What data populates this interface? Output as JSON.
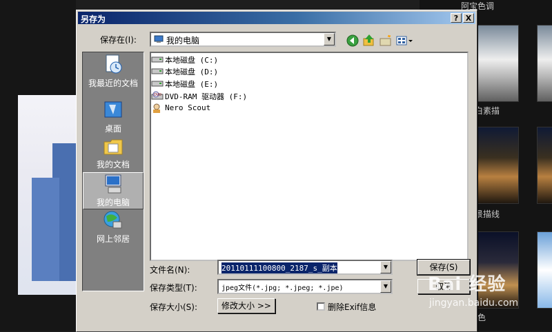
{
  "background": {
    "right_labels": [
      "阿宝色调",
      "黑白素描",
      "夜景描线",
      "单色"
    ]
  },
  "dialog": {
    "title": "另存为",
    "help_button": "?",
    "close_button": "X",
    "save_in_label": "保存在(I):",
    "save_in_value": "我的电脑",
    "places": [
      {
        "label": "我最近的文档",
        "icon": "recent-documents-icon"
      },
      {
        "label": "桌面",
        "icon": "desktop-icon"
      },
      {
        "label": "我的文档",
        "icon": "my-documents-icon"
      },
      {
        "label": "我的电脑",
        "icon": "my-computer-icon",
        "selected": true
      },
      {
        "label": "网上邻居",
        "icon": "network-places-icon"
      }
    ],
    "files": [
      {
        "name": "本地磁盘 (C:)",
        "icon": "hard-drive-icon"
      },
      {
        "name": "本地磁盘 (D:)",
        "icon": "hard-drive-icon"
      },
      {
        "name": "本地磁盘 (E:)",
        "icon": "hard-drive-icon"
      },
      {
        "name": "DVD-RAM 驱动器 (F:)",
        "icon": "dvd-drive-icon"
      },
      {
        "name": "Nero Scout",
        "icon": "nero-scout-icon"
      }
    ],
    "filename_label": "文件名(N):",
    "filename_value": "20110111100800_2187_s_副本",
    "filetype_label": "保存类型(T):",
    "filetype_value": "jpeg文件(*.jpg; *.jpeg; *.jpe)",
    "filesize_label": "保存大小(S):",
    "resize_button": "修改大小 >>",
    "exif_checkbox_label": "删除Exif信息",
    "save_button": "保存(S)",
    "cancel_button": "取消"
  },
  "watermark": {
    "main": "Bai 经验",
    "sub": "jingyan.baidu.com"
  }
}
